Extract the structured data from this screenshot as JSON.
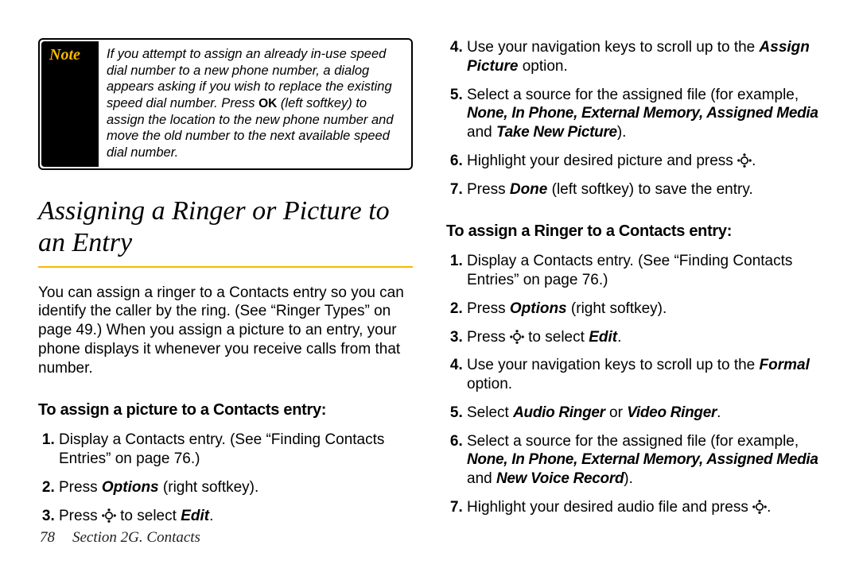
{
  "note": {
    "label": "Note",
    "text_a": "If you attempt to assign an already in-use speed dial number to a new phone number, a dialog appears asking if you wish to replace the existing speed dial number. Press ",
    "softkey": "OK",
    "text_b": " (left softkey) to assign the location to the new phone number and move the old number to the next available speed dial number."
  },
  "heading": "Assigning a Ringer or Picture to an Entry",
  "intro": "You can assign a ringer to a Contacts entry so you can identify the caller by the ring. (See “Ringer Types” on page 49.) When you assign a picture to an entry, your phone displays it whenever you receive calls from that number.",
  "pic": {
    "heading": "To assign a picture to a Contacts entry:",
    "s1": "Display a Contacts entry. (See “Finding Contacts Entries” on page 76.)",
    "s2a": "Press ",
    "s2opt": "Options",
    "s2b": " (right softkey).",
    "s3a": "Press ",
    "s3b": " to select ",
    "s3edit": "Edit",
    "s3c": ".",
    "s4a": "Use your navigation keys to scroll up to the ",
    "s4b": "Assign Picture",
    "s4c": " option.",
    "s5a": "Select a source for the assigned file (for example, ",
    "s5b": "None, In Phone, External Memory, Assigned Media",
    "s5c": " and ",
    "s5d": "Take New Picture",
    "s5e": ").",
    "s6a": "Highlight your desired picture and press ",
    "s6b": ".",
    "s7a": "Press ",
    "s7b": "Done",
    "s7c": " (left softkey) to save the entry."
  },
  "ring": {
    "heading": "To assign a Ringer to a Contacts entry:",
    "s1": "Display a Contacts entry. (See “Finding Contacts Entries” on page 76.)",
    "s2a": "Press ",
    "s2opt": "Options",
    "s2b": " (right softkey).",
    "s3a": "Press ",
    "s3b": " to select ",
    "s3edit": "Edit",
    "s3c": ".",
    "s4a": "Use your navigation keys to scroll up to the ",
    "s4b": "Formal",
    "s4c": " option.",
    "s5a": "Select ",
    "s5b": "Audio Ringer",
    "s5c": " or ",
    "s5d": "Video Ringer",
    "s5e": ".",
    "s6a": "Select a source for the assigned file (for example, ",
    "s6b": "None, In Phone, External Memory, Assigned Media",
    "s6c": " and ",
    "s6d": "New Voice Record",
    "s6e": ").",
    "s7a": "Highlight your desired audio file and press ",
    "s7b": "."
  },
  "footer": {
    "page": "78",
    "section": "Section 2G. Contacts"
  }
}
